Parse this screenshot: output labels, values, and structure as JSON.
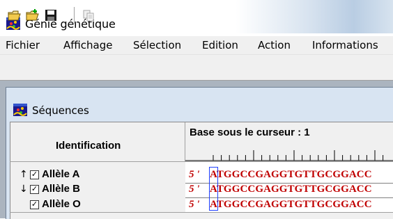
{
  "window": {
    "title": "Génie génétique"
  },
  "menu": [
    "Fichier",
    "Affichage",
    "Sélection",
    "Edition",
    "Action",
    "Informations"
  ],
  "toolbar": {
    "buttons": [
      {
        "icon": "open-folder-icon"
      },
      {
        "icon": "open-folder-plus-icon"
      },
      {
        "icon": "save-disk-icon"
      },
      {
        "icon": "copy-icon"
      }
    ]
  },
  "child_window": {
    "title": "Séquences"
  },
  "table": {
    "id_header": "Identification",
    "cursor_label": "Base sous le curseur : 1",
    "rows": [
      {
        "arrow": "↑",
        "checked": true,
        "label": "Allèle A",
        "prime": "5 '",
        "sequence": "ATGGCCGAGGTGTTGCGGACC"
      },
      {
        "arrow": "↓",
        "checked": true,
        "label": "Allèle B",
        "prime": "5 '",
        "sequence": "ATGGCCGAGGTGTTGCGGACC"
      },
      {
        "arrow": "",
        "checked": true,
        "label": "Allèle O",
        "prime": "5 '",
        "sequence": "ATGGCCGAGGTGTTGCGGACC"
      }
    ]
  },
  "colors": {
    "sequence_text": "#c00000",
    "cursor_box": "#2040ff",
    "mdi_background": "#abb4bf"
  }
}
